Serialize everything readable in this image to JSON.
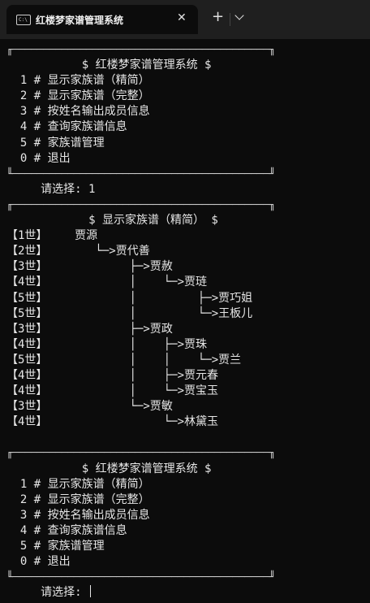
{
  "window": {
    "tab_title": "红楼梦家谱管理系统",
    "tab_icon": "terminal-icon",
    "close_glyph": "✕",
    "new_tab_glyph": "+"
  },
  "menu1": {
    "top_border": "╓──────────────────────────────────────────╖",
    "header": "           $ 红楼梦家谱管理系统 $",
    "items": [
      "  1 # 显示家族谱（精简）",
      "  2 # 显示家族谱（完整）",
      "  3 # 按姓名输出成员信息",
      "  4 # 查询家族谱信息",
      "  5 # 家族谱管理",
      "  0 # 退出"
    ],
    "bottom_border": "╙──────────────────────────────────────────╜"
  },
  "prompt1": "     请选择: 1",
  "tree": {
    "top_border": "╓──────────────────────────────────────────╖",
    "header": "            $ 显示家族谱（精简） $",
    "rows": [
      "【1世】    贾源",
      "【2世】       └─>贾代善",
      "【3世】            ├─>贾赦",
      "【4世】            │    └─>贾琏",
      "【5世】            │         ├─>贾巧姐",
      "【5世】            │         └─>王板儿",
      "【3世】            ├─>贾政",
      "【4世】            │    ├─>贾珠",
      "【5世】            │    │    └─>贾兰",
      "【4世】            │    ├─>贾元春",
      "【4世】            │    └─>贾宝玉",
      "【3世】            └─>贾敏",
      "【4世】                 └─>林黛玉"
    ],
    "bottom_border": "╙──────────────────────────────────────────╜"
  },
  "menu2": {
    "top_border": "╓──────────────────────────────────────────╖",
    "header": "           $ 红楼梦家谱管理系统 $",
    "items": [
      "  1 # 显示家族谱（精简）",
      "  2 # 显示家族谱（完整）",
      "  3 # 按姓名输出成员信息",
      "  4 # 查询家族谱信息",
      "  5 # 家族谱管理",
      "  0 # 退出"
    ],
    "bottom_border": "╙──────────────────────────────────────────╜"
  },
  "prompt2": "     请选择: "
}
